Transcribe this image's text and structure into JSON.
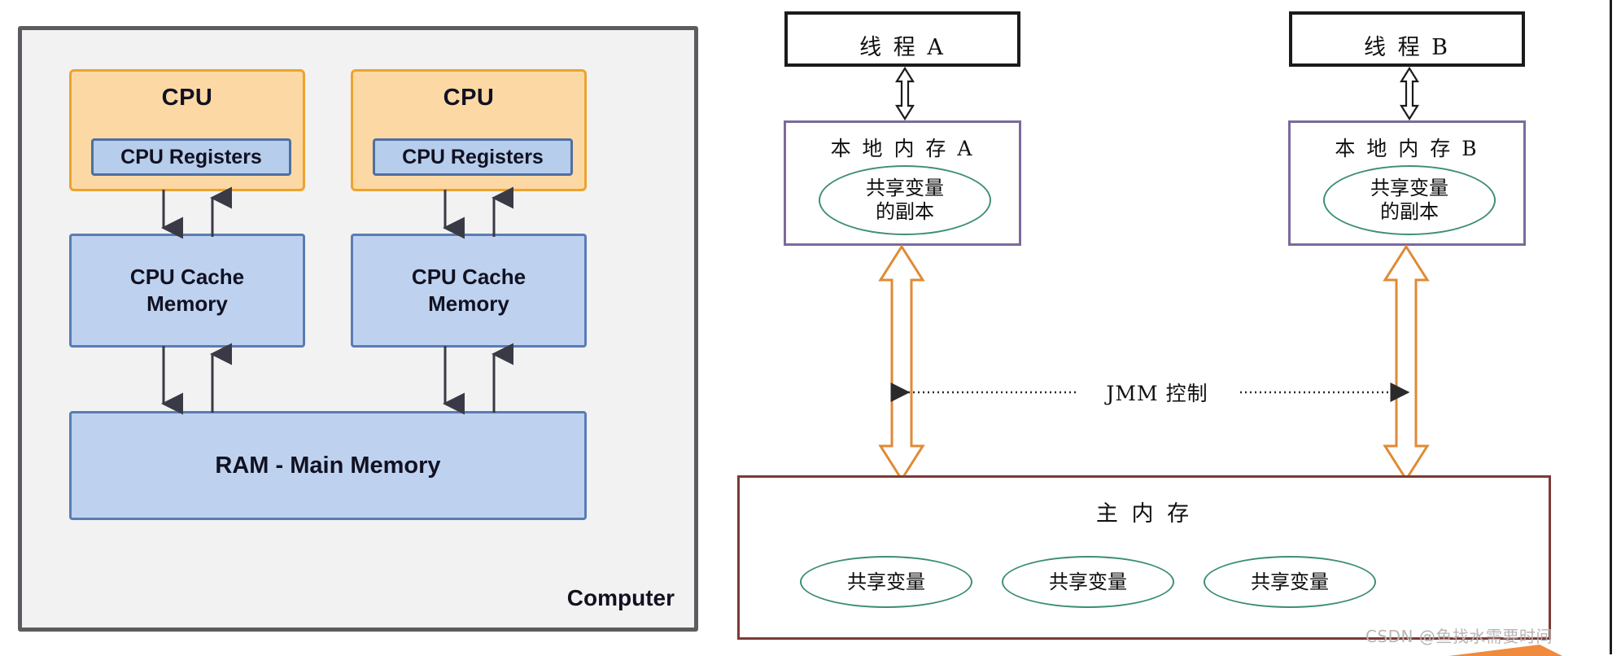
{
  "left_panel": {
    "name": "computer-hardware-memory-diagram",
    "container_label": "Computer",
    "cpus": [
      {
        "title": "CPU",
        "registers_label": "CPU Registers",
        "cache_label_line1": "CPU Cache",
        "cache_label_line2": "Memory"
      },
      {
        "title": "CPU",
        "registers_label": "CPU Registers",
        "cache_label_line1": "CPU Cache",
        "cache_label_line2": "Memory"
      }
    ],
    "ram_label": "RAM - Main Memory",
    "colors": {
      "cpu_fill": "#fcd9a4",
      "cpu_border": "#eda32f",
      "cache_fill": "#bed2ef",
      "cache_border": "#5b7cb4",
      "register_fill": "#b6cdeb",
      "register_border": "#4f6fa3",
      "container_border": "#5c5c60",
      "container_fill": "#f2f2f2",
      "arrow": "#3a3a46"
    }
  },
  "right_panel": {
    "name": "java-memory-model-diagram",
    "threads": [
      {
        "label": "线 程 A"
      },
      {
        "label": "线 程 B"
      }
    ],
    "local_memories": [
      {
        "label": "本 地 内 存 A",
        "variable_line1": "共享变量",
        "variable_line2": "的副本"
      },
      {
        "label": "本 地 内 存 B",
        "variable_line1": "共享变量",
        "variable_line2": "的副本"
      }
    ],
    "control_label": "JMM 控制",
    "main_memory": {
      "label": "主 内 存",
      "variables": [
        "共享变量",
        "共享变量",
        "共享变量"
      ]
    },
    "colors": {
      "thread_border": "#1b1b1b",
      "local_border": "#7b6a9c",
      "ellipse_border": "#3f8f72",
      "main_memory_border": "#7b3a36",
      "orange_arrow": "#e08a34",
      "dotted_arrow": "#2a2a2a"
    }
  },
  "watermark": {
    "text": "CSDN @鱼找水需要时间"
  }
}
